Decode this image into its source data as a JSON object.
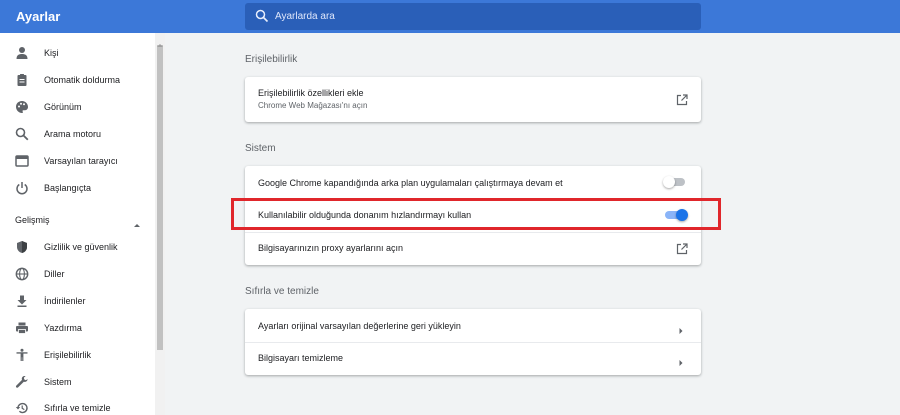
{
  "app": {
    "title": "Ayarlar"
  },
  "search": {
    "placeholder": "Ayarlarda ara",
    "value": ""
  },
  "colors": {
    "header": "#3c78d8",
    "accent": "#1a73e8",
    "highlight": "#e0262b"
  },
  "sidebar": {
    "items": [
      {
        "label": "Kişi",
        "icon": "person-icon"
      },
      {
        "label": "Otomatik doldurma",
        "icon": "clipboard-icon"
      },
      {
        "label": "Görünüm",
        "icon": "palette-icon"
      },
      {
        "label": "Arama motoru",
        "icon": "search-icon"
      },
      {
        "label": "Varsayılan tarayıcı",
        "icon": "browser-window-icon"
      },
      {
        "label": "Başlangıçta",
        "icon": "power-icon"
      }
    ],
    "advanced_label": "Gelişmiş",
    "advanced_items": [
      {
        "label": "Gizlilik ve güvenlik",
        "icon": "shield-icon"
      },
      {
        "label": "Diller",
        "icon": "globe-icon"
      },
      {
        "label": "İndirilenler",
        "icon": "download-icon"
      },
      {
        "label": "Yazdırma",
        "icon": "printer-icon"
      },
      {
        "label": "Erişilebilirlik",
        "icon": "accessibility-icon"
      },
      {
        "label": "Sistem",
        "icon": "wrench-icon"
      },
      {
        "label": "Sıfırla ve temizle",
        "icon": "restore-icon"
      }
    ]
  },
  "accessibility": {
    "title": "Erişilebilirlik",
    "row": {
      "title": "Erişilebilirlik özellikleri ekle",
      "subtitle": "Chrome Web Mağazası'nı açın"
    }
  },
  "system": {
    "title": "Sistem",
    "rows": [
      {
        "title": "Google Chrome kapandığında arka plan uygulamaları çalıştırmaya devam et",
        "toggle": false
      },
      {
        "title": "Kullanılabilir olduğunda donanım hızlandırmayı kullan",
        "toggle": true
      },
      {
        "title": "Bilgisayarınızın proxy ayarlarını açın"
      }
    ]
  },
  "reset": {
    "title": "Sıfırla ve temizle",
    "rows": [
      {
        "title": "Ayarları orijinal varsayılan değerlerine geri yükleyin"
      },
      {
        "title": "Bilgisayarı temizleme"
      }
    ]
  }
}
